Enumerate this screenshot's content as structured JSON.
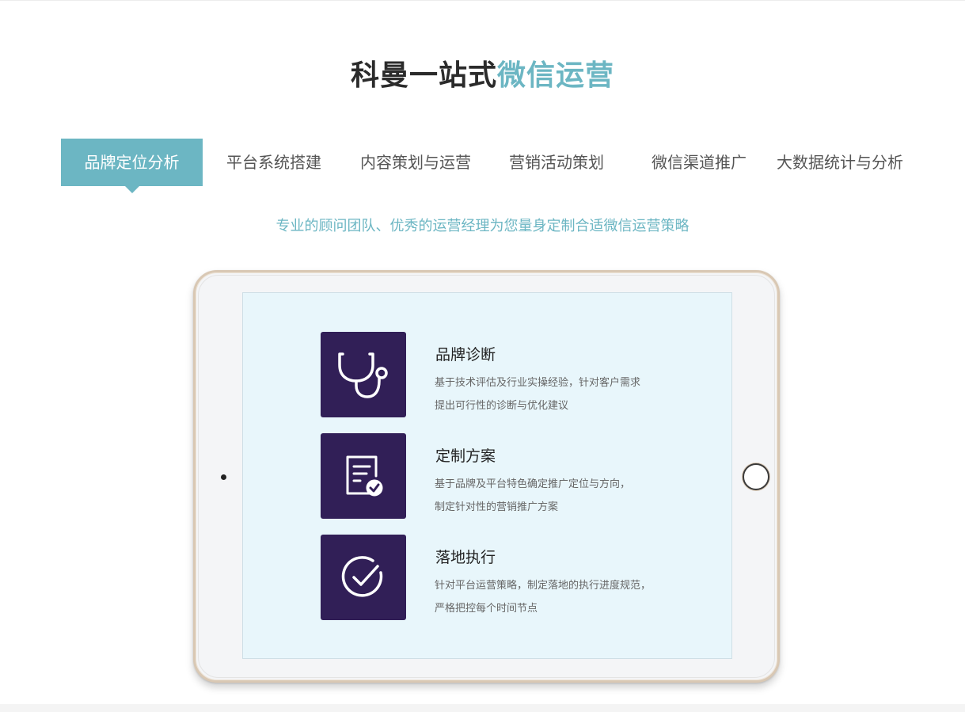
{
  "heading": {
    "main": "科曼一站式",
    "accent": "微信运营"
  },
  "tabs": [
    {
      "label": "品牌定位分析",
      "active": true
    },
    {
      "label": "平台系统搭建",
      "active": false
    },
    {
      "label": "内容策划与运营",
      "active": false
    },
    {
      "label": "营销活动策划",
      "active": false
    },
    {
      "label": "微信渠道推广",
      "active": false
    },
    {
      "label": "大数据统计与分析",
      "active": false
    }
  ],
  "subtitle": "专业的顾问团队、优秀的运营经理为您量身定制合适微信运营策略",
  "features": [
    {
      "icon": "stethoscope-icon",
      "title": "品牌诊断",
      "desc_line1": "基于技术评估及行业实操经验，针对客户需求",
      "desc_line2": "提出可行性的诊断与优化建议"
    },
    {
      "icon": "document-check-icon",
      "title": "定制方案",
      "desc_line1": "基于品牌及平台特色确定推广定位与方向，",
      "desc_line2": "制定针对性的营销推广方案"
    },
    {
      "icon": "circle-check-icon",
      "title": "落地执行",
      "desc_line1": "针对平台运营策略，制定落地的执行进度规范，",
      "desc_line2": "严格把控每个时间节点"
    }
  ],
  "colors": {
    "accent": "#6cb6c3",
    "icon_bg": "#311f57",
    "screen_bg": "#e8f6fb"
  }
}
